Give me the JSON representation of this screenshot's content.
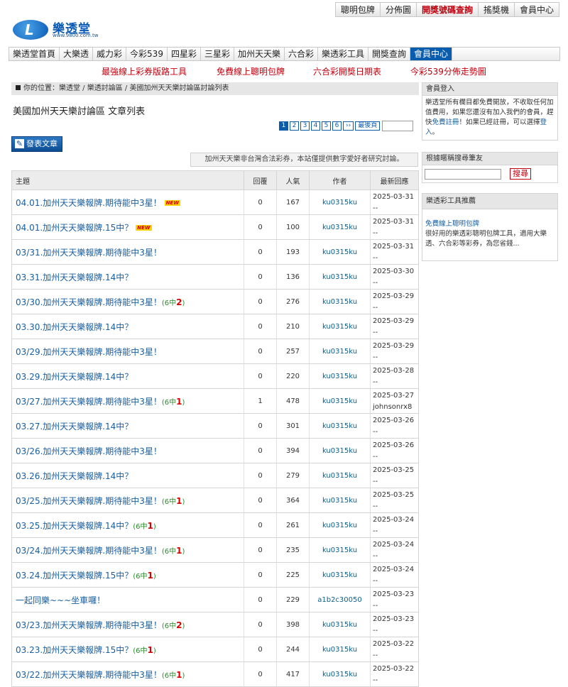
{
  "toplinks": [
    {
      "label": "聰明包牌",
      "highlight": false
    },
    {
      "label": "分佈圖",
      "highlight": false
    },
    {
      "label": "開獎號碼查詢",
      "highlight": true
    },
    {
      "label": "搖獎機",
      "highlight": false
    },
    {
      "label": "會員中心",
      "highlight": false
    }
  ],
  "logo": {
    "name": "樂透堂",
    "url": "www.9800.com.tw",
    "mark": "L"
  },
  "nav": [
    "樂透堂首頁",
    "大樂透",
    "威力彩",
    "今彩539",
    "四星彩",
    "三星彩",
    "加州天天樂",
    "六合彩",
    "樂透彩工具",
    "開獎查詢",
    "會員中心"
  ],
  "promo": [
    "最強線上彩券版路工具",
    "免費線上聰明包牌",
    "六合彩開獎日期表",
    "今彩539分佈走勢圖"
  ],
  "breadcrumb": "你的位置：樂透堂 / 樂透討論區 / 美國加州天天樂討論區討論列表",
  "page_title": "美國加州天天樂討論區 文章列表",
  "pager": {
    "pages": [
      "1",
      "2",
      "3",
      "4",
      "5",
      "6"
    ],
    "next": "››",
    "last": "最後頁"
  },
  "post_button": "發表文章",
  "notice": "加州天天樂非台灣合法彩券，本站僅提供數字愛好者研究討論。",
  "table": {
    "headers": {
      "title": "主題",
      "replies": "回覆",
      "views": "人氣",
      "author": "作者",
      "last": "最新回應"
    },
    "rows": [
      {
        "title": "04.01.加州天天樂報牌.期待能中3星！",
        "badge": "NEW",
        "hit_pre": "",
        "hit_num": "",
        "hit_post": "",
        "replies": "0",
        "views": "167",
        "author": "ku0315ku",
        "last_date": "2025-03-31",
        "last_user": "--"
      },
      {
        "title": "04.01.加州天天樂報牌.15中？",
        "badge": "NEW",
        "hit_pre": "",
        "hit_num": "",
        "hit_post": "",
        "replies": "0",
        "views": "100",
        "author": "ku0315ku",
        "last_date": "2025-03-31",
        "last_user": "--"
      },
      {
        "title": "03/31.加州天天樂報牌.期待能中3星！",
        "badge": "",
        "hit_pre": "",
        "hit_num": "",
        "hit_post": "",
        "replies": "0",
        "views": "193",
        "author": "ku0315ku",
        "last_date": "2025-03-31",
        "last_user": "--"
      },
      {
        "title": "03.31.加州天天樂報牌.14中？",
        "badge": "",
        "hit_pre": "",
        "hit_num": "",
        "hit_post": "",
        "replies": "0",
        "views": "136",
        "author": "ku0315ku",
        "last_date": "2025-03-30",
        "last_user": "--"
      },
      {
        "title": "03/30.加州天天樂報牌.期待能中3星！",
        "badge": "",
        "hit_pre": "(6中",
        "hit_num": "2",
        "hit_post": ")",
        "replies": "0",
        "views": "276",
        "author": "ku0315ku",
        "last_date": "2025-03-29",
        "last_user": "--"
      },
      {
        "title": "03.30.加州天天樂報牌.14中？",
        "badge": "",
        "hit_pre": "",
        "hit_num": "",
        "hit_post": "",
        "replies": "0",
        "views": "210",
        "author": "ku0315ku",
        "last_date": "2025-03-29",
        "last_user": "--"
      },
      {
        "title": "03/29.加州天天樂報牌.期待能中3星！",
        "badge": "",
        "hit_pre": "",
        "hit_num": "",
        "hit_post": "",
        "replies": "0",
        "views": "257",
        "author": "ku0315ku",
        "last_date": "2025-03-29",
        "last_user": "--"
      },
      {
        "title": "03.29.加州天天樂報牌.14中？",
        "badge": "",
        "hit_pre": "",
        "hit_num": "",
        "hit_post": "",
        "replies": "0",
        "views": "220",
        "author": "ku0315ku",
        "last_date": "2025-03-28",
        "last_user": "--"
      },
      {
        "title": "03/27.加州天天樂報牌.期待能中3星！",
        "badge": "",
        "hit_pre": "(6中",
        "hit_num": "1",
        "hit_post": ")",
        "replies": "1",
        "views": "478",
        "author": "ku0315ku",
        "last_date": "2025-03-27",
        "last_user": "johnsonrx8"
      },
      {
        "title": "03.27.加州天天樂報牌.14中？",
        "badge": "",
        "hit_pre": "",
        "hit_num": "",
        "hit_post": "",
        "replies": "0",
        "views": "301",
        "author": "ku0315ku",
        "last_date": "2025-03-26",
        "last_user": "--"
      },
      {
        "title": "03/26.加州天天樂報牌.期待能中3星！",
        "badge": "",
        "hit_pre": "",
        "hit_num": "",
        "hit_post": "",
        "replies": "0",
        "views": "394",
        "author": "ku0315ku",
        "last_date": "2025-03-26",
        "last_user": "--"
      },
      {
        "title": "03.26.加州天天樂報牌.14中？",
        "badge": "",
        "hit_pre": "",
        "hit_num": "",
        "hit_post": "",
        "replies": "0",
        "views": "279",
        "author": "ku0315ku",
        "last_date": "2025-03-25",
        "last_user": "--"
      },
      {
        "title": "03/25.加州天天樂報牌.期待能中3星！",
        "badge": "",
        "hit_pre": "(6中",
        "hit_num": "1",
        "hit_post": ")",
        "replies": "0",
        "views": "364",
        "author": "ku0315ku",
        "last_date": "2025-03-25",
        "last_user": "--"
      },
      {
        "title": "03.25.加州天天樂報牌.14中？",
        "badge": "",
        "hit_pre": "(6中",
        "hit_num": "1",
        "hit_post": ")",
        "replies": "0",
        "views": "261",
        "author": "ku0315ku",
        "last_date": "2025-03-24",
        "last_user": "--"
      },
      {
        "title": "03/24.加州天天樂報牌.期待能中3星！",
        "badge": "",
        "hit_pre": "(6中",
        "hit_num": "1",
        "hit_post": ")",
        "replies": "0",
        "views": "235",
        "author": "ku0315ku",
        "last_date": "2025-03-24",
        "last_user": "--"
      },
      {
        "title": "03.24.加州天天樂報牌.15中？",
        "badge": "",
        "hit_pre": "(6中",
        "hit_num": "1",
        "hit_post": ")",
        "replies": "0",
        "views": "225",
        "author": "ku0315ku",
        "last_date": "2025-03-24",
        "last_user": "--"
      },
      {
        "title": "一起同樂~~~坐車囉！",
        "badge": "",
        "hit_pre": "",
        "hit_num": "",
        "hit_post": "",
        "replies": "0",
        "views": "229",
        "author": "a1b2c30050",
        "last_date": "2025-03-23",
        "last_user": "--"
      },
      {
        "title": "03/23.加州天天樂報牌.期待能中3星！",
        "badge": "",
        "hit_pre": "(6中",
        "hit_num": "2",
        "hit_post": ")",
        "replies": "0",
        "views": "398",
        "author": "ku0315ku",
        "last_date": "2025-03-23",
        "last_user": "--"
      },
      {
        "title": "03.23.加州天天樂報牌.15中？",
        "badge": "",
        "hit_pre": "(6中",
        "hit_num": "1",
        "hit_post": ")",
        "replies": "0",
        "views": "244",
        "author": "ku0315ku",
        "last_date": "2025-03-22",
        "last_user": "--"
      },
      {
        "title": "03/22.加州天天樂報牌.期待能中3星！",
        "badge": "",
        "hit_pre": "(6中",
        "hit_num": "1",
        "hit_post": ")",
        "replies": "0",
        "views": "417",
        "author": "ku0315ku",
        "last_date": "2025-03-22",
        "last_user": "--"
      }
    ]
  },
  "sidebar": {
    "login_title": "會員登入",
    "login_text_1": "樂透堂所有欄目都免費開放，不收取任何加值費用，如果您還沒有加入我們的會員，趕快",
    "login_link_register": "免費註冊",
    "login_text_2": "！如果已經註冊，可以選擇",
    "login_link_login": "登入",
    "login_text_3": "。",
    "search_title": "根據暱稱搜尋筆友",
    "search_button": "搜尋",
    "tools_title": "樂透彩工具推薦",
    "tool_name": "免費線上聰明包牌",
    "tool_desc": "很好用的樂透彩聰明包牌工具，適用大樂透、六合彩等彩券，為您省錢..."
  }
}
